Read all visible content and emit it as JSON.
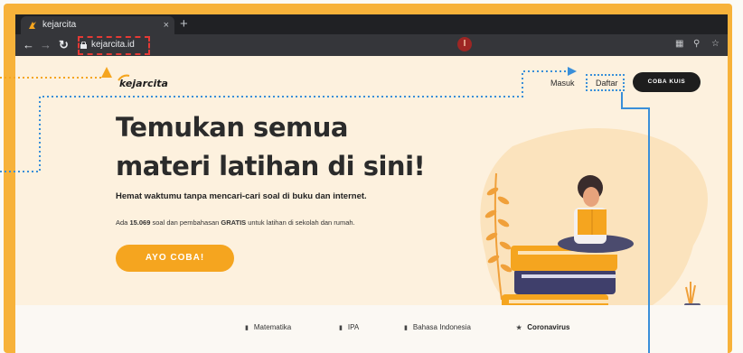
{
  "browser": {
    "tab_title": "kejarcita",
    "tab_close": "×",
    "new_tab": "+",
    "url": "kejarcita.id",
    "extension_badge": "I"
  },
  "nav": {
    "logo_text": "kejarcita",
    "masuk": "Masuk",
    "daftar": "Daftar",
    "coba_kuis": "COBA KUIS"
  },
  "hero": {
    "title_line1": "Temukan semua",
    "title_line2": "materi latihan di sini!",
    "subtitle": "Hemat waktumu tanpa mencari-cari soal di buku dan internet.",
    "desc_prefix": "Ada ",
    "desc_count": "15.069",
    "desc_mid": " soal dan pembahasan ",
    "desc_gratis": "GRATIS",
    "desc_suffix": " untuk latihan di sekolah dan rumah.",
    "cta": "AYO COBA!"
  },
  "categories": [
    {
      "label": "Matematika",
      "icon": "book-icon"
    },
    {
      "label": "IPA",
      "icon": "book-icon"
    },
    {
      "label": "Bahasa Indonesia",
      "icon": "book-icon"
    },
    {
      "label": "Coronavirus",
      "icon": "star-icon"
    }
  ],
  "colors": {
    "frame": "#f7b23a",
    "accent_orange": "#f5a51f",
    "dark_button": "#1e1e1e",
    "page_bg": "#fdf1de",
    "annotation_blue": "#3a8fd9",
    "annotation_red": "#e53935"
  }
}
